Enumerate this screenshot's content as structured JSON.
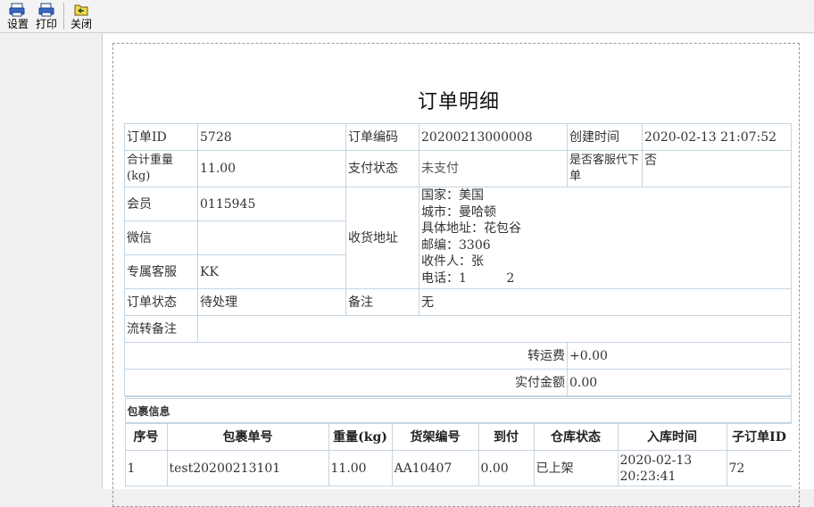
{
  "toolbar": {
    "buttons": [
      {
        "label": "设置",
        "icon": "settings-printer-icon"
      },
      {
        "label": "打印",
        "icon": "printer-icon"
      },
      {
        "label": "关闭",
        "icon": "close-folder-icon"
      }
    ]
  },
  "document": {
    "title": "订单明细",
    "order_id_label": "订单ID",
    "order_id": "5728",
    "order_no_label": "订单编码",
    "order_no": "20200213000008",
    "created_label": "创建时间",
    "created": "2020-02-13 21:07:52",
    "weight_label": "合计重量(kg)",
    "weight": "11.00",
    "pay_status_label": "支付状态",
    "pay_status": "未支付",
    "by_cs_label": "是否客服代下单",
    "by_cs": "否",
    "member_label": "会员",
    "member": "0115945",
    "wechat_label": "微信",
    "wechat": "",
    "cs_label": "专属客服",
    "cs": "KK",
    "address_label": "收货地址",
    "address_lines": [
      "国家：美国",
      "城市：曼哈顿",
      "具体地址：花包谷",
      "邮编：3306",
      "收件人：张",
      "电话：1          2"
    ],
    "status_label": "订单状态",
    "status": "待处理",
    "remark_label": "备注",
    "remark": "无",
    "flow_remark_label": "流转备注",
    "flow_remark": "",
    "freight_label": "转运费",
    "freight": "+0.00",
    "paid_label": "实付金额",
    "paid": "0.00",
    "package_title": "包裹信息",
    "package_headers": [
      "序号",
      "包裹单号",
      "重量(kg)",
      "货架编号",
      "到付",
      "仓库状态",
      "入库时间",
      "子订单ID"
    ],
    "package_rows": [
      [
        "1",
        "test20200213101",
        "11.00",
        "AA10407",
        "0.00",
        "已上架",
        "2020-02-13 20:23:41",
        "72"
      ]
    ]
  },
  "colors": {
    "status_green": "#1aa05a",
    "amount_red": "#d40000",
    "border": "#c5d5e2"
  }
}
